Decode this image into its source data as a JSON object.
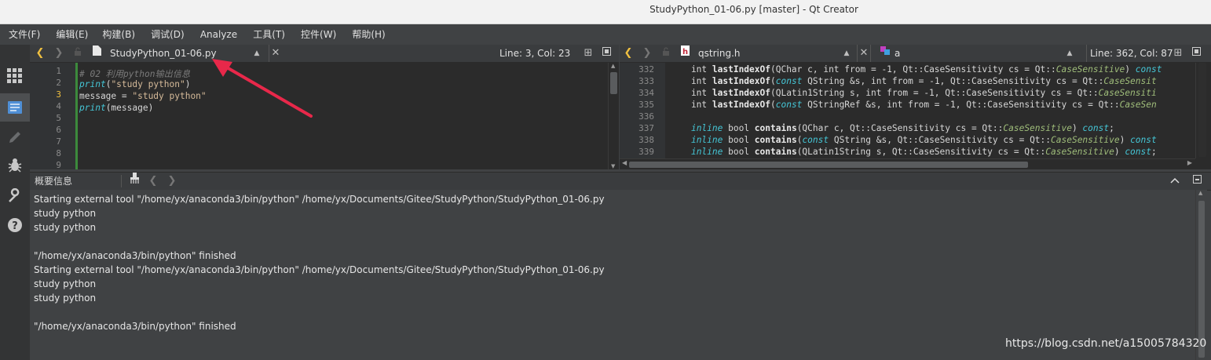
{
  "window": {
    "title": "StudyPython_01-06.py [master] - Qt Creator"
  },
  "menu": [
    "文件(F)",
    "编辑(E)",
    "构建(B)",
    "调试(D)",
    "Analyze",
    "工具(T)",
    "控件(W)",
    "帮助(H)"
  ],
  "modes": [
    "welcome-icon",
    "edit-icon",
    "design-icon",
    "debug-icon",
    "projects-icon",
    "help-icon"
  ],
  "left_editor": {
    "file_name": "StudyPython_01-06.py",
    "position": "Line: 3, Col: 23",
    "line_numbers": [
      "1",
      "2",
      "3",
      "4",
      "5",
      "6",
      "7",
      "8",
      "9"
    ],
    "lines": [
      {
        "parts": [
          {
            "t": "# 02 利用python输出信息",
            "c": "com"
          }
        ]
      },
      {
        "parts": [
          {
            "t": "print",
            "c": "fn"
          },
          {
            "t": "(",
            "c": "kw"
          },
          {
            "t": "\"study python\"",
            "c": "str"
          },
          {
            "t": ")",
            "c": "kw"
          }
        ]
      },
      {
        "parts": [
          {
            "t": "message = ",
            "c": "kw"
          },
          {
            "t": "\"study python\"",
            "c": "str"
          }
        ]
      },
      {
        "parts": [
          {
            "t": "print",
            "c": "fn"
          },
          {
            "t": "(message)",
            "c": "kw"
          }
        ]
      }
    ]
  },
  "right_editor": {
    "file_name": "qstring.h",
    "symbol": "a",
    "position": "Line: 362, Col: 87",
    "line_numbers": [
      "332",
      "333",
      "334",
      "335",
      "336",
      "337",
      "338",
      "339"
    ],
    "lines": [
      {
        "parts": [
          {
            "t": "    int ",
            "c": "kw"
          },
          {
            "t": "lastIndexOf",
            "c": "bold"
          },
          {
            "t": "(QChar c, int from = ",
            "c": "kw"
          },
          {
            "t": "-1",
            "c": "num"
          },
          {
            "t": ", Qt::CaseSensitivity cs = Qt::",
            "c": "kw"
          },
          {
            "t": "CaseSensitive",
            "c": "enum"
          },
          {
            "t": ") ",
            "c": "kw"
          },
          {
            "t": "const",
            "c": "it"
          }
        ]
      },
      {
        "parts": [
          {
            "t": "    int ",
            "c": "kw"
          },
          {
            "t": "lastIndexOf",
            "c": "bold"
          },
          {
            "t": "(",
            "c": "kw"
          },
          {
            "t": "const",
            "c": "it"
          },
          {
            "t": " QString &s, int from = ",
            "c": "kw"
          },
          {
            "t": "-1",
            "c": "num"
          },
          {
            "t": ", Qt::CaseSensitivity cs = Qt::",
            "c": "kw"
          },
          {
            "t": "CaseSensit",
            "c": "enum"
          }
        ]
      },
      {
        "parts": [
          {
            "t": "    int ",
            "c": "kw"
          },
          {
            "t": "lastIndexOf",
            "c": "bold"
          },
          {
            "t": "(QLatin1String s, int from = ",
            "c": "kw"
          },
          {
            "t": "-1",
            "c": "num"
          },
          {
            "t": ", Qt::CaseSensitivity cs = Qt::",
            "c": "kw"
          },
          {
            "t": "CaseSensiti",
            "c": "enum"
          }
        ]
      },
      {
        "parts": [
          {
            "t": "    int ",
            "c": "kw"
          },
          {
            "t": "lastIndexOf",
            "c": "bold"
          },
          {
            "t": "(",
            "c": "kw"
          },
          {
            "t": "const",
            "c": "it"
          },
          {
            "t": " QStringRef &s, int from = ",
            "c": "kw"
          },
          {
            "t": "-1",
            "c": "num"
          },
          {
            "t": ", Qt::CaseSensitivity cs = Qt::",
            "c": "kw"
          },
          {
            "t": "CaseSen",
            "c": "enum"
          }
        ]
      },
      {
        "parts": []
      },
      {
        "parts": [
          {
            "t": "    ",
            "c": "kw"
          },
          {
            "t": "inline",
            "c": "it"
          },
          {
            "t": " bool ",
            "c": "kw"
          },
          {
            "t": "contains",
            "c": "bold"
          },
          {
            "t": "(QChar c, Qt::CaseSensitivity cs = Qt::",
            "c": "kw"
          },
          {
            "t": "CaseSensitive",
            "c": "enum"
          },
          {
            "t": ") ",
            "c": "kw"
          },
          {
            "t": "const",
            "c": "it"
          },
          {
            "t": ";",
            "c": "kw"
          }
        ]
      },
      {
        "parts": [
          {
            "t": "    ",
            "c": "kw"
          },
          {
            "t": "inline",
            "c": "it"
          },
          {
            "t": " bool ",
            "c": "kw"
          },
          {
            "t": "contains",
            "c": "bold"
          },
          {
            "t": "(",
            "c": "kw"
          },
          {
            "t": "const",
            "c": "it"
          },
          {
            "t": " QString &s, Qt::CaseSensitivity cs = Qt::",
            "c": "kw"
          },
          {
            "t": "CaseSensitive",
            "c": "enum"
          },
          {
            "t": ") ",
            "c": "kw"
          },
          {
            "t": "const",
            "c": "it"
          }
        ]
      },
      {
        "parts": [
          {
            "t": "    ",
            "c": "kw"
          },
          {
            "t": "inline",
            "c": "it"
          },
          {
            "t": " bool ",
            "c": "kw"
          },
          {
            "t": "contains",
            "c": "bold"
          },
          {
            "t": "(QLatin1String s, Qt::CaseSensitivity cs = Qt::",
            "c": "kw"
          },
          {
            "t": "CaseSensitive",
            "c": "enum"
          },
          {
            "t": ") ",
            "c": "kw"
          },
          {
            "t": "const",
            "c": "it"
          },
          {
            "t": ";",
            "c": "kw"
          }
        ]
      }
    ]
  },
  "output_pane": {
    "title": "概要信息",
    "lines": [
      "Starting external tool \"/home/yx/anaconda3/bin/python\" /home/yx/Documents/Gitee/StudyPython/StudyPython_01-06.py",
      "study python",
      "study python",
      "",
      "\"/home/yx/anaconda3/bin/python\" finished",
      "Starting external tool \"/home/yx/anaconda3/bin/python\" /home/yx/Documents/Gitee/StudyPython/StudyPython_01-06.py",
      "study python",
      "study python",
      "",
      "\"/home/yx/anaconda3/bin/python\" finished"
    ]
  },
  "watermark": "https://blog.csdn.net/a15005784320",
  "colors": {
    "annotation_arrow": "#e8284a",
    "accent_nav": "#f0c040"
  }
}
